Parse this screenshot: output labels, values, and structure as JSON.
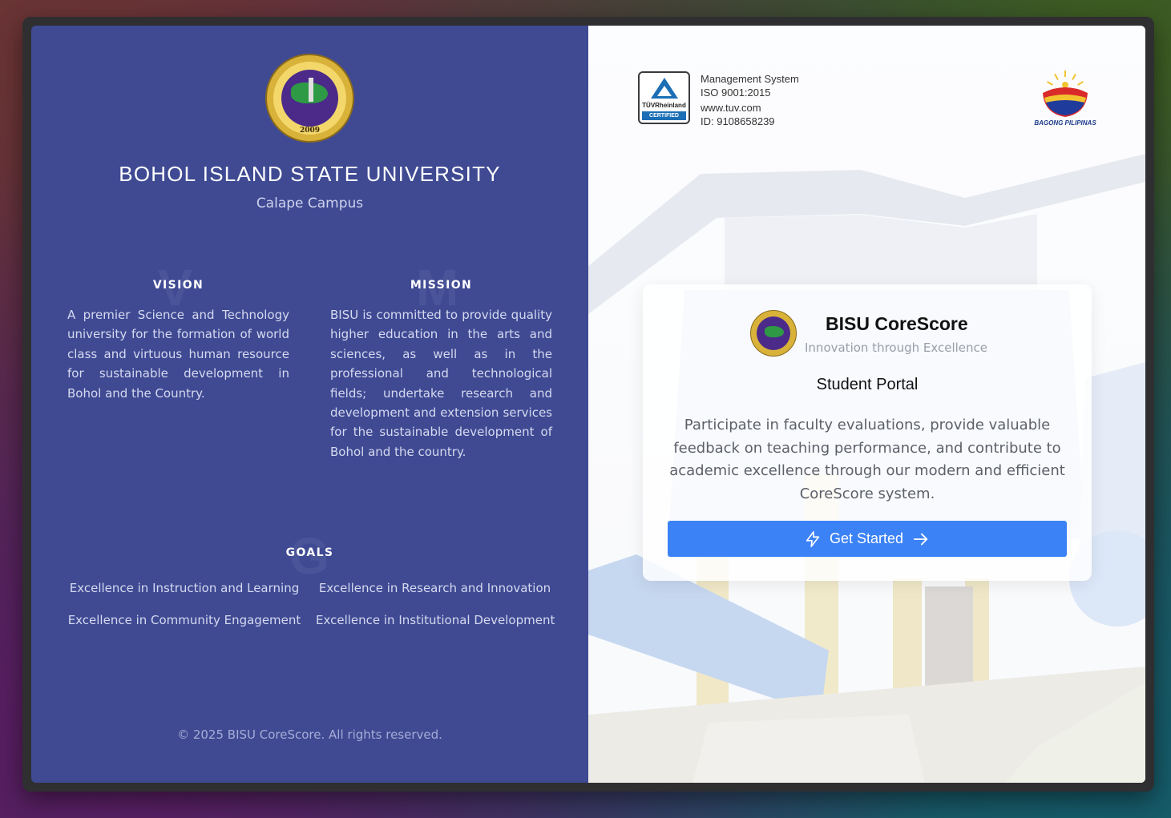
{
  "university": {
    "title": "BOHOL ISLAND STATE UNIVERSITY",
    "campus": "Calape Campus",
    "seal_text": "BOHOL ISLAND STATE UNIVERSITY",
    "seal_year": "2009"
  },
  "vision": {
    "heading": "VISION",
    "ghost_letter": "V",
    "text": "A premier Science and Technology university for the formation of world class and virtuous human resource for sustainable development in Bohol and the Country."
  },
  "mission": {
    "heading": "MISSION",
    "ghost_letter": "M",
    "text": "BISU is committed to provide quality higher education in the arts and sciences, as well as in the professional and technological fields; undertake research and development and extension services for the sustainable development of Bohol and the country."
  },
  "goals": {
    "heading": "GOALS",
    "ghost_letter": "G",
    "items": [
      "Excellence in Instruction and Learning",
      "Excellence in Research and Innovation",
      "Excellence in Community Engagement",
      "Excellence in Institutional Development"
    ]
  },
  "footer": "© 2025 BISU CoreScore. All rights reserved.",
  "certification": {
    "badge_name": "TÜVRheinland",
    "badge_label": "CERTIFIED",
    "lines": [
      "Management System",
      "ISO 9001:2015",
      "www.tuv.com",
      "ID: 9108658239"
    ]
  },
  "bagong_pilipinas": "BAGONG PILIPINAS",
  "card": {
    "app_name": "BISU CoreScore",
    "tagline": "Innovation through Excellence",
    "portal": "Student Portal",
    "description": "Participate in faculty evaluations, provide valuable feedback on teaching performance, and contribute to academic excellence through our modern and efficient CoreScore system.",
    "button_label": "Get Started",
    "button_icon": "lightning-icon",
    "button_arrow_icon": "arrow-right-icon"
  },
  "colors": {
    "left_panel": "#3f4a93",
    "button": "#3b82f6"
  }
}
